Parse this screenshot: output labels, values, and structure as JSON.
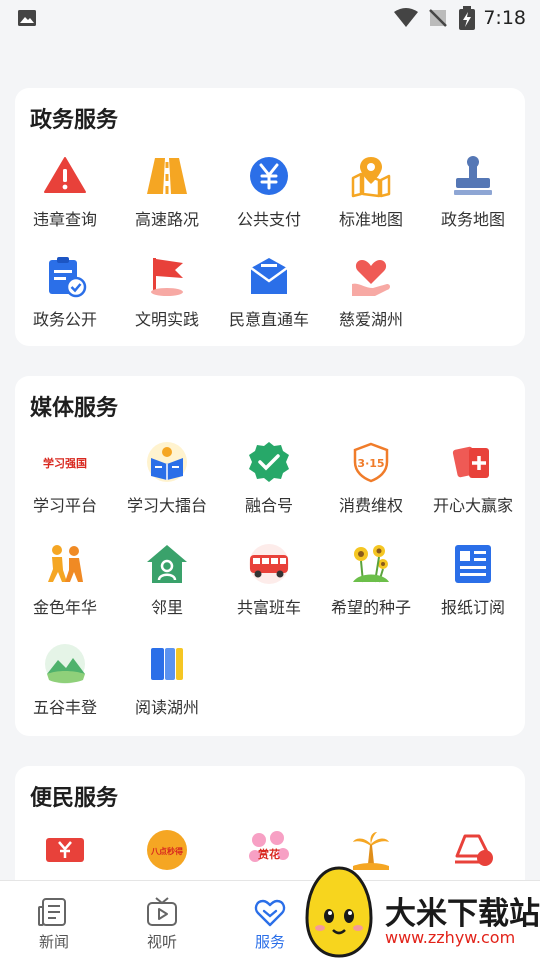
{
  "status_bar": {
    "time": "7:18",
    "icons": [
      "image-icon",
      "wifi-icon",
      "no-signal-icon",
      "battery-charging-icon"
    ]
  },
  "sections": [
    {
      "title": "政务服务",
      "items": [
        {
          "label": "违章查询",
          "icon": "warning-triangle-icon"
        },
        {
          "label": "高速路况",
          "icon": "highway-road-icon"
        },
        {
          "label": "公共支付",
          "icon": "yuan-payment-icon"
        },
        {
          "label": "标准地图",
          "icon": "map-pin-icon"
        },
        {
          "label": "政务地图",
          "icon": "stamp-icon"
        },
        {
          "label": "政务公开",
          "icon": "clipboard-check-icon"
        },
        {
          "label": "文明实践",
          "icon": "red-flag-icon"
        },
        {
          "label": "民意直通车",
          "icon": "mail-envelope-icon"
        },
        {
          "label": "慈爱湖州",
          "icon": "heart-hand-icon"
        }
      ]
    },
    {
      "title": "媒体服务",
      "items": [
        {
          "label": "学习平台",
          "icon": "xuexi-logo-icon",
          "logo_text": "学习强国"
        },
        {
          "label": "学习大擂台",
          "icon": "book-reader-icon"
        },
        {
          "label": "融合号",
          "icon": "check-badge-icon"
        },
        {
          "label": "消费维权",
          "icon": "consumer-315-icon",
          "logo_text": "3·15"
        },
        {
          "label": "开心大赢家",
          "icon": "playing-cards-icon"
        },
        {
          "label": "金色年华",
          "icon": "elderly-people-icon"
        },
        {
          "label": "邻里",
          "icon": "house-person-icon"
        },
        {
          "label": "共富班车",
          "icon": "bus-icon"
        },
        {
          "label": "希望的种子",
          "icon": "sunflower-icon"
        },
        {
          "label": "报纸订阅",
          "icon": "newspaper-icon"
        },
        {
          "label": "五谷丰登",
          "icon": "mountain-field-icon"
        },
        {
          "label": "阅读湖州",
          "icon": "open-book-icon"
        }
      ]
    },
    {
      "title": "便民服务",
      "items": [
        {
          "label": "",
          "icon": "ticket-yuan-icon"
        },
        {
          "label": "",
          "icon": "badge-logo-icon",
          "logo_text": "八点秒得"
        },
        {
          "label": "",
          "icon": "flower-badge-icon",
          "logo_text": "赏花"
        },
        {
          "label": "",
          "icon": "palm-tree-icon"
        },
        {
          "label": "",
          "icon": "car-icon"
        }
      ]
    }
  ],
  "tabbar": [
    {
      "label": "新闻",
      "icon": "news-doc-icon"
    },
    {
      "label": "视听",
      "icon": "tv-play-icon"
    },
    {
      "label": "服务",
      "icon": "heart-chevron-icon",
      "active": true
    }
  ],
  "watermark": {
    "title": "大米下载站",
    "url": "www.zzhyw.com"
  },
  "colors": {
    "accent": "#2b6fe8",
    "red": "#e8413a",
    "orange": "#f5a623",
    "green": "#27a869",
    "card": "#ffffff",
    "bg": "#f4f5f7"
  }
}
